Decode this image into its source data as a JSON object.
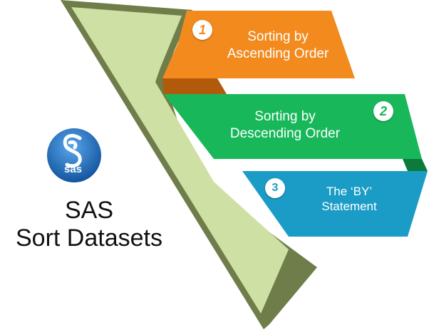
{
  "logo": {
    "text": "sas"
  },
  "title": {
    "line1": "SAS",
    "line2": "Sort Datasets"
  },
  "steps": [
    {
      "number": "1",
      "line1": "Sorting by",
      "line2": "Ascending Order"
    },
    {
      "number": "2",
      "line1": "Sorting by",
      "line2": "Descending Order"
    },
    {
      "number": "3",
      "line1": "The ‘BY’",
      "line2": "Statement"
    }
  ],
  "colors": {
    "step1": "#f28a1e",
    "step2": "#18b85a",
    "step3": "#1b9cc6",
    "chevron_light": "#cfe0a4",
    "chevron_dark": "#6f7d4a",
    "logo_blue": "#1f73c8"
  }
}
